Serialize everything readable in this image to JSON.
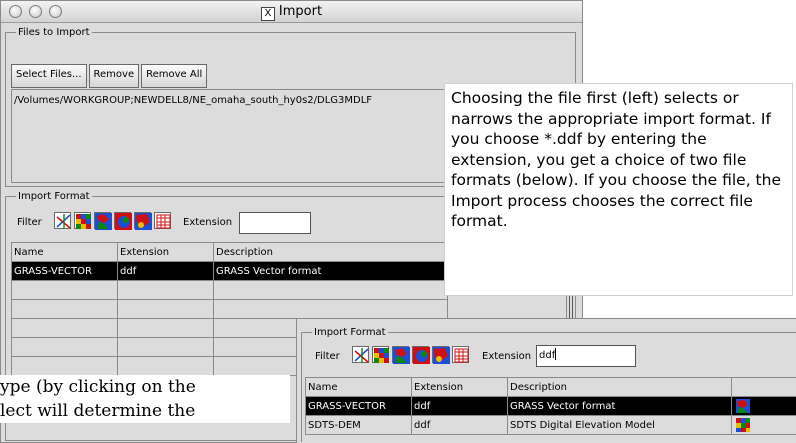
{
  "window": {
    "title": "Import"
  },
  "files_group": {
    "legend": "Files to Import",
    "buttons": {
      "select": "Select Files...",
      "remove": "Remove",
      "remove_all": "Remove All"
    },
    "path": "/Volumes/WORKGROUP;NEWDELL8/NE_omaha_south_hy0s2/DLG3MDLF"
  },
  "format_group": {
    "legend": "Import Format",
    "filter_label": "Filter",
    "extension_label": "Extension",
    "extension_value": "",
    "columns": [
      "Name",
      "Extension",
      "Description"
    ],
    "rows": [
      {
        "name": "GRASS-VECTOR",
        "ext": "ddf",
        "desc": "GRASS Vector format"
      }
    ]
  },
  "callout": {
    "text": "Choosing the file first (left) selects or narrows the appropriate import format.  If you choose *.ddf by entering the extension, you get a choice of two file formats (below). If you choose the file, the Import process chooses the correct file format."
  },
  "overlay": {
    "legend": "Import Format",
    "filter_label": "Filter",
    "extension_label": "Extension",
    "extension_value": "ddf",
    "columns": [
      "Name",
      "Extension",
      "Description"
    ],
    "rows": [
      {
        "name": "GRASS-VECTOR",
        "ext": "ddf",
        "desc": "GRASS Vector format",
        "icon": "vector-map-icon"
      },
      {
        "name": "SDTS-DEM",
        "ext": "ddf",
        "desc": "SDTS Digital Elevation Model",
        "icon": "raster-grid-icon"
      }
    ]
  },
  "bottom_text": {
    "line1": "ype (by clicking on the",
    "line2": "lect will determine the"
  },
  "colors": {
    "selection": "#000000",
    "window_bg": "#dcdcdc"
  }
}
